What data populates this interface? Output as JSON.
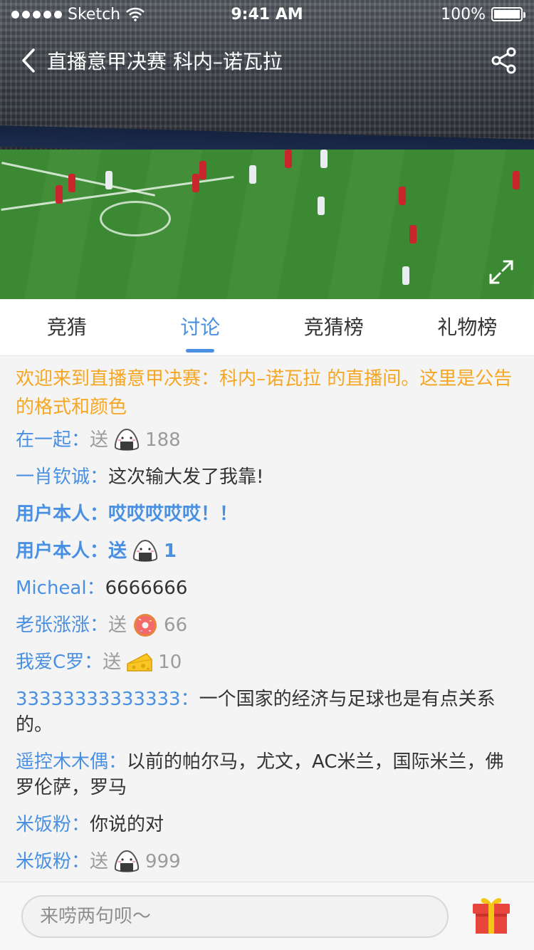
{
  "status_bar": {
    "carrier": "Sketch",
    "time": "9:41 AM",
    "battery": "100%"
  },
  "header": {
    "title": "直播意甲决赛 科内–诺瓦拉"
  },
  "tabs": [
    {
      "label": "竞猜"
    },
    {
      "label": "讨论"
    },
    {
      "label": "竞猜榜"
    },
    {
      "label": "礼物榜"
    }
  ],
  "chat": {
    "notice": "欢迎来到直播意甲决赛：科内–诺瓦拉 的直播间。这里是公告的格式和颜色",
    "messages": [
      {
        "name": "在一起：",
        "send": "送",
        "gift": "rice-ball-icon",
        "qty": "188"
      },
      {
        "name": "一肖钦诚：",
        "text": "这次输大发了我靠!"
      },
      {
        "name": "用户本人：",
        "text": "哎哎哎哎哎！！"
      },
      {
        "name": "用户本人：",
        "send": "送",
        "gift": "rice-ball-icon",
        "qty": "1"
      },
      {
        "name": "Micheal：",
        "text": "6666666"
      },
      {
        "name": "老张涨涨：",
        "send": "送",
        "gift": "donut-icon",
        "qty": "66"
      },
      {
        "name": "我爱C罗：",
        "send": "送",
        "gift": "cheese-icon",
        "qty": "10"
      },
      {
        "name": "33333333333333：",
        "text": "一个国家的经济与足球也是有点关系的。"
      },
      {
        "name": "遥控木木偶：",
        "text": "以前的帕尔马，尤文，AC米兰，国际米兰，佛罗伦萨，罗马"
      },
      {
        "name": "米饭粉：",
        "text": "你说的对"
      },
      {
        "name": "米饭粉：",
        "send": "送",
        "gift": "rice-ball-icon",
        "qty": "999"
      }
    ]
  },
  "composer": {
    "placeholder": "来唠两句呗～"
  },
  "colors": {
    "accent": "#4a90e2",
    "notice": "#f5a623",
    "muted": "#9b9b9b"
  }
}
